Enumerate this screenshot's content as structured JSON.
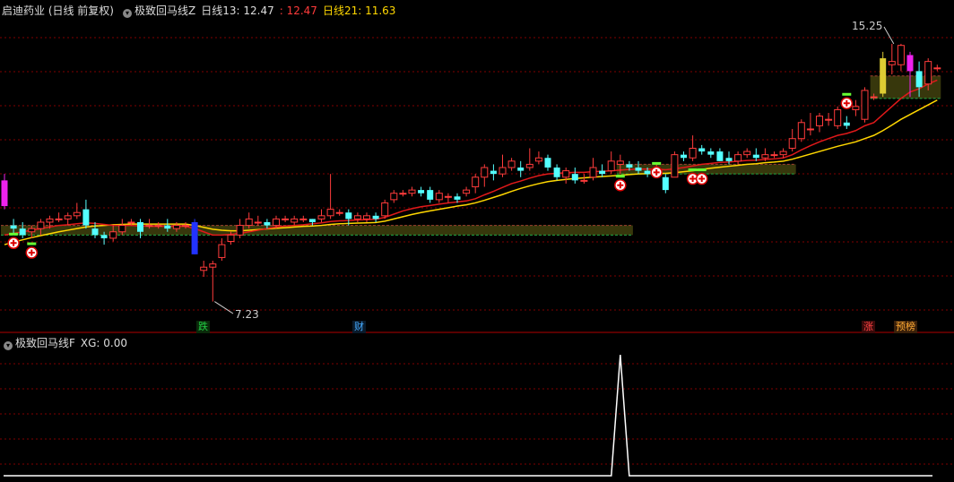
{
  "main_header": {
    "stock_label": "启迪药业 (日线 前复权)",
    "indicator_name": "极致回马线Z",
    "line13_label": "日线13: 12.47",
    "value_mid": ": 12.47",
    "line21_label": "日线21: 11.63"
  },
  "sub_header": {
    "indicator_name": "极致回马线F",
    "xg_label": "XG: 0.00"
  },
  "annotations": {
    "high_price": "15.25",
    "low_price": "7.23"
  },
  "event_markers": [
    {
      "label": "跌",
      "color": "#22cc44"
    },
    {
      "label": "财",
      "color": "#44aaff"
    },
    {
      "label": "涨",
      "color": "#ff4444"
    },
    {
      "label": "预榜",
      "color": "#ffaa33"
    }
  ],
  "colors": {
    "up": "#ff3b3b",
    "down": "#54ffff",
    "line13": "#e0191a",
    "line21": "#ffd700",
    "zone_fill": "#4a4a10",
    "zone_border": "#22aa44",
    "grid": "#800000",
    "xg_line": "#ffffff"
  },
  "chart_data": {
    "type": "candlestick",
    "price_range": [
      6.8,
      16.0
    ],
    "candles": [
      [
        0,
        11.0,
        10.2,
        11.2,
        10.1
      ],
      [
        1,
        9.6,
        9.5,
        9.8,
        9.3
      ],
      [
        2,
        9.5,
        9.3,
        9.7,
        9.2
      ],
      [
        3,
        9.4,
        9.5,
        9.6,
        9.2
      ],
      [
        4,
        9.5,
        9.7,
        9.8,
        9.3
      ],
      [
        5,
        9.7,
        9.8,
        9.9,
        9.5
      ],
      [
        6,
        9.8,
        9.8,
        10.0,
        9.7
      ],
      [
        7,
        9.8,
        9.9,
        10.0,
        9.6
      ],
      [
        8,
        9.9,
        10.0,
        10.3,
        9.8
      ],
      [
        9,
        10.1,
        9.6,
        10.4,
        9.5
      ],
      [
        10,
        9.5,
        9.3,
        9.7,
        9.2
      ],
      [
        11,
        9.3,
        9.2,
        9.4,
        9.0
      ],
      [
        12,
        9.2,
        9.4,
        9.6,
        9.1
      ],
      [
        13,
        9.4,
        9.6,
        9.8,
        9.3
      ],
      [
        14,
        9.7,
        9.7,
        9.8,
        9.6
      ],
      [
        15,
        9.7,
        9.4,
        9.8,
        9.2
      ],
      [
        16,
        9.6,
        9.6,
        9.8,
        9.5
      ],
      [
        17,
        9.6,
        9.6,
        9.7,
        9.5
      ],
      [
        18,
        9.6,
        9.5,
        9.8,
        9.4
      ],
      [
        19,
        9.5,
        9.6,
        9.7,
        9.4
      ],
      [
        20,
        9.6,
        9.6,
        9.7,
        9.5
      ],
      [
        21,
        9.7,
        8.7,
        9.8,
        8.7
      ],
      [
        22,
        8.2,
        8.3,
        8.5,
        8.0
      ],
      [
        23,
        8.3,
        8.4,
        8.5,
        7.23
      ],
      [
        24,
        8.6,
        9.0,
        9.2,
        8.5
      ],
      [
        25,
        9.1,
        9.3,
        9.4,
        9.0
      ],
      [
        26,
        9.3,
        9.6,
        9.8,
        9.2
      ],
      [
        27,
        9.6,
        9.8,
        10.0,
        9.5
      ],
      [
        28,
        9.7,
        9.7,
        9.9,
        9.6
      ],
      [
        29,
        9.7,
        9.6,
        9.8,
        9.5
      ],
      [
        30,
        9.6,
        9.8,
        9.9,
        9.5
      ],
      [
        31,
        9.8,
        9.8,
        9.9,
        9.7
      ],
      [
        32,
        9.7,
        9.8,
        9.9,
        9.6
      ],
      [
        33,
        9.8,
        9.8,
        9.9,
        9.7
      ],
      [
        34,
        9.8,
        9.7,
        9.8,
        9.6
      ],
      [
        35,
        9.8,
        9.9,
        10.1,
        9.7
      ],
      [
        36,
        9.9,
        10.1,
        11.2,
        9.8
      ],
      [
        37,
        10.0,
        10.0,
        10.1,
        9.9
      ],
      [
        38,
        10.0,
        9.8,
        10.1,
        9.6
      ],
      [
        39,
        9.8,
        9.9,
        10.0,
        9.7
      ],
      [
        40,
        9.8,
        9.9,
        10.0,
        9.7
      ],
      [
        41,
        9.9,
        9.8,
        10.0,
        9.7
      ],
      [
        42,
        9.9,
        10.3,
        10.4,
        9.8
      ],
      [
        43,
        10.4,
        10.6,
        10.7,
        10.3
      ],
      [
        44,
        10.6,
        10.6,
        10.7,
        10.5
      ],
      [
        45,
        10.6,
        10.7,
        10.8,
        10.5
      ],
      [
        46,
        10.7,
        10.6,
        10.8,
        10.5
      ],
      [
        47,
        10.7,
        10.4,
        10.8,
        10.3
      ],
      [
        48,
        10.4,
        10.6,
        10.7,
        10.3
      ],
      [
        49,
        10.5,
        10.5,
        10.6,
        10.3
      ],
      [
        50,
        10.5,
        10.4,
        10.6,
        10.3
      ],
      [
        51,
        10.6,
        10.7,
        10.8,
        10.5
      ],
      [
        52,
        10.8,
        11.1,
        11.2,
        10.6
      ],
      [
        53,
        11.1,
        11.4,
        11.5,
        10.8
      ],
      [
        54,
        11.3,
        11.2,
        11.5,
        11.0
      ],
      [
        55,
        11.2,
        11.4,
        11.8,
        11.1
      ],
      [
        56,
        11.4,
        11.6,
        11.7,
        11.3
      ],
      [
        57,
        11.4,
        11.3,
        11.6,
        11.1
      ],
      [
        58,
        11.4,
        11.5,
        12.0,
        11.3
      ],
      [
        59,
        11.6,
        11.7,
        11.9,
        11.5
      ],
      [
        60,
        11.7,
        11.4,
        11.8,
        11.3
      ],
      [
        61,
        11.4,
        11.1,
        11.5,
        11.0
      ],
      [
        62,
        11.1,
        11.3,
        11.4,
        10.9
      ],
      [
        63,
        11.2,
        11.0,
        11.4,
        10.9
      ],
      [
        64,
        11.0,
        11.0,
        11.2,
        10.9
      ],
      [
        65,
        11.1,
        11.4,
        11.7,
        11.0
      ],
      [
        66,
        11.3,
        11.2,
        11.5,
        11.1
      ],
      [
        67,
        11.3,
        11.6,
        11.9,
        11.2
      ],
      [
        68,
        11.5,
        11.6,
        11.8,
        11.2
      ],
      [
        69,
        11.5,
        11.4,
        11.6,
        11.3
      ],
      [
        70,
        11.4,
        11.3,
        11.6,
        11.2
      ],
      [
        71,
        11.3,
        11.2,
        11.4,
        11.1
      ],
      [
        72,
        11.2,
        11.3,
        11.5,
        11.1
      ],
      [
        73,
        11.1,
        10.7,
        11.2,
        10.6
      ],
      [
        74,
        11.1,
        11.8,
        11.9,
        11.1
      ],
      [
        75,
        11.8,
        11.7,
        11.9,
        11.6
      ],
      [
        76,
        11.7,
        12.0,
        12.4,
        11.6
      ],
      [
        77,
        12.0,
        11.9,
        12.1,
        11.8
      ],
      [
        78,
        11.9,
        11.8,
        12.0,
        11.7
      ],
      [
        79,
        11.9,
        11.6,
        12.0,
        11.6
      ],
      [
        80,
        11.7,
        11.6,
        11.9,
        11.5
      ],
      [
        81,
        11.6,
        11.8,
        11.9,
        11.5
      ],
      [
        82,
        11.8,
        11.9,
        12.0,
        11.7
      ],
      [
        83,
        11.8,
        11.7,
        12.0,
        11.6
      ],
      [
        84,
        11.7,
        11.8,
        12.0,
        11.6
      ],
      [
        85,
        11.8,
        11.8,
        11.9,
        11.7
      ],
      [
        86,
        11.8,
        11.9,
        12.0,
        11.7
      ],
      [
        87,
        12.0,
        12.3,
        12.6,
        11.9
      ],
      [
        88,
        12.3,
        12.8,
        12.9,
        12.2
      ],
      [
        89,
        12.6,
        12.6,
        13.1,
        12.4
      ],
      [
        90,
        12.7,
        13.0,
        13.1,
        12.5
      ],
      [
        91,
        12.9,
        12.9,
        13.1,
        12.7
      ],
      [
        92,
        12.7,
        13.2,
        13.3,
        12.6
      ],
      [
        93,
        12.8,
        12.7,
        13.0,
        12.6
      ],
      [
        94,
        13.2,
        13.3,
        13.5,
        13.0
      ],
      [
        95,
        12.9,
        13.8,
        13.9,
        12.8
      ],
      [
        96,
        13.6,
        13.6,
        13.7,
        13.5
      ],
      [
        97,
        13.7,
        14.8,
        15.0,
        13.6
      ],
      [
        98,
        14.6,
        14.7,
        15.25,
        14.3
      ],
      [
        99,
        14.6,
        15.2,
        15.25,
        14.4
      ],
      [
        100,
        14.9,
        14.4,
        15.0,
        13.6
      ],
      [
        101,
        14.4,
        13.9,
        14.7,
        13.6
      ],
      [
        102,
        14.0,
        14.7,
        14.8,
        13.8
      ],
      [
        103,
        14.5,
        14.5,
        14.6,
        14.4
      ]
    ],
    "line13": [
      9.3,
      9.35,
      9.4,
      9.45,
      9.5,
      9.55,
      9.6,
      9.62,
      9.65,
      9.68,
      9.66,
      9.63,
      9.6,
      9.6,
      9.6,
      9.58,
      9.57,
      9.57,
      9.57,
      9.57,
      9.57,
      9.5,
      9.4,
      9.3,
      9.3,
      9.32,
      9.35,
      9.4,
      9.45,
      9.5,
      9.55,
      9.58,
      9.6,
      9.62,
      9.65,
      9.68,
      9.72,
      9.74,
      9.75,
      9.77,
      9.78,
      9.79,
      9.85,
      9.95,
      10.05,
      10.12,
      10.18,
      10.22,
      10.26,
      10.3,
      10.33,
      10.36,
      10.43,
      10.55,
      10.66,
      10.78,
      10.9,
      10.98,
      11.07,
      11.15,
      11.2,
      11.22,
      11.24,
      11.25,
      11.25,
      11.27,
      11.28,
      11.3,
      11.32,
      11.34,
      11.35,
      11.35,
      11.35,
      11.33,
      11.36,
      11.4,
      11.45,
      11.5,
      11.53,
      11.56,
      11.57,
      11.6,
      11.62,
      11.63,
      11.65,
      11.67,
      11.7,
      11.8,
      11.95,
      12.08,
      12.2,
      12.3,
      12.4,
      12.46,
      12.55,
      12.7,
      12.8,
      13.05,
      13.3,
      13.55,
      13.75,
      13.85,
      14.0,
      14.12
    ],
    "line21": [
      9.0,
      9.08,
      9.15,
      9.22,
      9.28,
      9.34,
      9.4,
      9.45,
      9.5,
      9.55,
      9.58,
      9.6,
      9.62,
      9.63,
      9.64,
      9.64,
      9.64,
      9.64,
      9.64,
      9.64,
      9.64,
      9.6,
      9.54,
      9.48,
      9.45,
      9.43,
      9.43,
      9.45,
      9.47,
      9.49,
      9.51,
      9.53,
      9.55,
      9.57,
      9.58,
      9.6,
      9.63,
      9.65,
      9.66,
      9.67,
      9.68,
      9.69,
      9.73,
      9.8,
      9.87,
      9.94,
      10.0,
      10.05,
      10.1,
      10.15,
      10.2,
      10.24,
      10.3,
      10.38,
      10.47,
      10.56,
      10.66,
      10.75,
      10.83,
      10.9,
      10.96,
      11.0,
      11.03,
      11.06,
      11.08,
      11.1,
      11.12,
      11.14,
      11.16,
      11.18,
      11.2,
      11.21,
      11.22,
      11.22,
      11.24,
      11.27,
      11.3,
      11.34,
      11.38,
      11.41,
      11.44,
      11.47,
      11.5,
      11.52,
      11.55,
      11.57,
      11.6,
      11.66,
      11.74,
      11.82,
      11.9,
      11.98,
      12.06,
      12.13,
      12.2,
      12.3,
      12.4,
      12.55,
      12.72,
      12.9,
      13.05,
      13.2,
      13.35,
      13.5
    ],
    "zones": [
      {
        "start": 0,
        "end": 69,
        "low": 9.3,
        "high": 9.6
      },
      {
        "start": 68,
        "end": 87,
        "low": 11.2,
        "high": 11.5
      },
      {
        "start": 96,
        "end": 103,
        "low": 13.55,
        "high": 14.25
      }
    ],
    "buy_signals": [
      {
        "index": 1,
        "price": 9.05
      },
      {
        "index": 3,
        "price": 8.75
      },
      {
        "index": 68,
        "price": 10.85
      },
      {
        "index": 72,
        "price": 11.25
      },
      {
        "index": 76,
        "price": 11.05
      },
      {
        "index": 77,
        "price": 11.05
      },
      {
        "index": 93,
        "price": 13.4
      }
    ],
    "xg_values": {
      "spike_index": 68,
      "spike_value": 1,
      "baseline": 0
    },
    "xg_range": [
      0,
      1
    ]
  }
}
